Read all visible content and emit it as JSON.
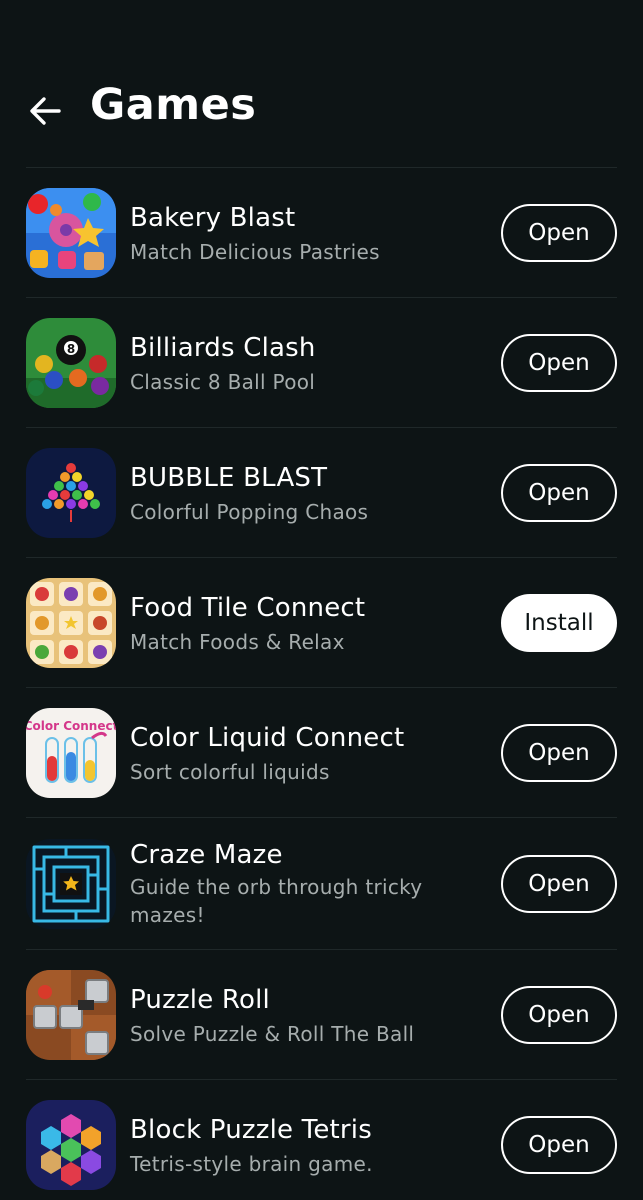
{
  "header": {
    "title": "Games"
  },
  "apps": [
    {
      "name": "Bakery Blast",
      "description": "Match Delicious Pastries",
      "action": "Open"
    },
    {
      "name": "Billiards Clash",
      "description": "Classic 8 Ball Pool",
      "action": "Open"
    },
    {
      "name": "BUBBLE BLAST",
      "description": "Colorful Popping Chaos",
      "action": "Open"
    },
    {
      "name": "Food Tile Connect",
      "description": "Match Foods & Relax",
      "action": "Install"
    },
    {
      "name": "Color Liquid Connect",
      "description": "Sort colorful liquids",
      "action": "Open",
      "icon_text": "Color Connect"
    },
    {
      "name": "Craze Maze",
      "description": "Guide the orb through tricky mazes!",
      "action": "Open"
    },
    {
      "name": "Puzzle Roll",
      "description": "Solve Puzzle & Roll The Ball",
      "action": "Open"
    },
    {
      "name": "Block Puzzle Tetris",
      "description": "Tetris-style brain game.",
      "action": "Open"
    }
  ],
  "colors": {
    "background": "#0d1415",
    "text_primary": "#ffffff",
    "text_secondary": "#a6adad",
    "divider": "#1f2829",
    "install_button_bg": "#ffffff"
  },
  "icons": {
    "back": "arrow-left-icon",
    "app_icons": [
      "bakery-blast-icon",
      "billiards-clash-icon",
      "bubble-blast-icon",
      "food-tile-connect-icon",
      "color-liquid-connect-icon",
      "craze-maze-icon",
      "puzzle-roll-icon",
      "block-puzzle-tetris-icon"
    ]
  }
}
